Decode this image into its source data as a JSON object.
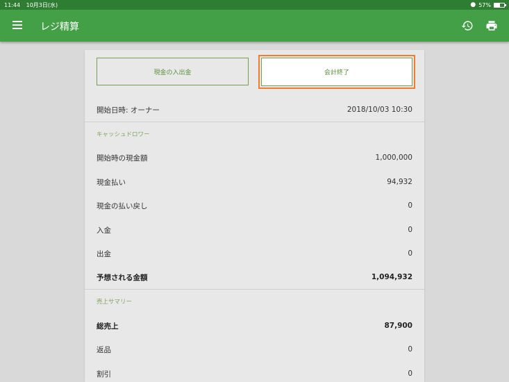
{
  "status_bar": {
    "time": "11:44",
    "date": "10月3日(水)",
    "battery": "57%"
  },
  "app_bar": {
    "title": "レジ精算"
  },
  "buttons": {
    "cash_in_out": "現金の入出金",
    "end_accounting": "会計終了"
  },
  "header_row": {
    "label": "開始日時: オーナー",
    "value": "2018/10/03 10:30"
  },
  "sections": {
    "cash_drawer": {
      "title": "キャッシュドロワー",
      "rows": [
        {
          "label": "開始時の現金額",
          "value": "1,000,000"
        },
        {
          "label": "現金払い",
          "value": "94,932"
        },
        {
          "label": "現金の払い戻し",
          "value": "0"
        },
        {
          "label": "入金",
          "value": "0"
        },
        {
          "label": "出金",
          "value": "0"
        },
        {
          "label": "予想される金額",
          "value": "1,094,932"
        }
      ]
    },
    "sales_summary": {
      "title": "売上サマリー",
      "rows": [
        {
          "label": "総売上",
          "value": "87,900"
        },
        {
          "label": "返品",
          "value": "0"
        },
        {
          "label": "割引",
          "value": "0"
        }
      ]
    }
  },
  "colors": {
    "app_bar": "#43a047",
    "status_bar": "#2e7d32",
    "accent": "#6fa24a",
    "focus": "#f07d2c"
  },
  "icons": {
    "menu": "menu-icon",
    "history": "history-icon",
    "print": "print-icon",
    "wifi": "wifi-icon",
    "battery": "battery-icon"
  }
}
